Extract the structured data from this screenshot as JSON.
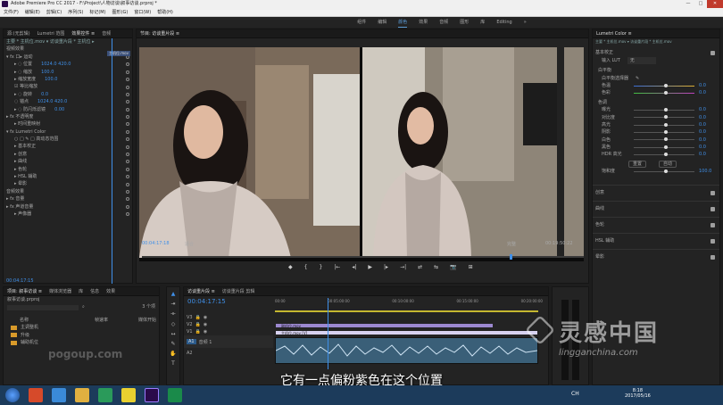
{
  "app": {
    "title": "Adobe Premiere Pro CC 2017 - F:\\Project\\人物访谈\\叙事访谈.prproj *"
  },
  "window_controls": [
    "—",
    "□",
    "✕"
  ],
  "menu": [
    "文件(F)",
    "编辑(E)",
    "剪辑(C)",
    "序列(S)",
    "标记(M)",
    "图形(G)",
    "窗口(W)",
    "帮助(H)"
  ],
  "workspaces": [
    "组件",
    "编辑",
    "颜色",
    "效果",
    "音频",
    "图形",
    "库",
    "Editing",
    "»"
  ],
  "left_panel": {
    "tabs": [
      "源:(无剪辑)",
      "Lumetri 范围",
      "效果控件 ≡",
      "音频"
    ],
    "master_label": "主要 * 主机位.mov ▾ 访谈重片段 * 主机位 ▸",
    "clip_label": "主机位.mov",
    "section": "视频效果",
    "rows": [
      {
        "label": "▾ fx 口▸ 运动",
        "value": ""
      },
      {
        "label": "▸ ◌ 位置",
        "value": "1024.0  420.0"
      },
      {
        "label": "▸ ◌ 缩放",
        "value": "100.0"
      },
      {
        "label": "▸ 缩放宽度",
        "value": "100.0"
      },
      {
        "label": "☑ 等比缩放",
        "value": ""
      },
      {
        "label": "▸ ◌ 旋转",
        "value": "0.0"
      },
      {
        "label": "◌ 锚点",
        "value": "1024.0  420.0"
      },
      {
        "label": "▸ ◌ 防闪烁滤镜",
        "value": "0.00"
      },
      {
        "label": "▸ fx 不透明度",
        "value": ""
      },
      {
        "label": "▸ 时间重映射",
        "value": ""
      },
      {
        "label": "▾ fx Lumetri Color",
        "value": ""
      },
      {
        "label": "○ □ ✎   □ 高动态范围",
        "value": ""
      },
      {
        "label": "▸ 基本校正",
        "value": ""
      },
      {
        "label": "▸ 创意",
        "value": ""
      },
      {
        "label": "▸ 曲线",
        "value": ""
      },
      {
        "label": "▸ 色轮",
        "value": ""
      },
      {
        "label": "▸ HSL 辅助",
        "value": ""
      },
      {
        "label": "▸ 晕影",
        "value": ""
      },
      {
        "label": "音频效果",
        "value": ""
      },
      {
        "label": "▸ fx 音量",
        "value": ""
      },
      {
        "label": "▸ fx 声道音量",
        "value": ""
      },
      {
        "label": "▸ 声像器",
        "value": ""
      }
    ],
    "timecode": "00:04:17:15"
  },
  "program": {
    "tab": "节目: 访谈重片段 ≡",
    "timecode_left": "00:04:17:18",
    "fit": "适合",
    "quality": "完整",
    "timecode_right": "00:19:50:22",
    "controls": [
      "◆",
      "{",
      "}",
      "|←",
      "◂|",
      "▶",
      "|▸",
      "→|",
      "⇄",
      "⇆",
      "📷",
      "⊞"
    ]
  },
  "project": {
    "tabs": [
      "项目: 叙事访谈 ≡",
      "媒体浏览器",
      "库",
      "信息",
      "效果"
    ],
    "file": "叙事访谈.prproj",
    "count": "3 个项",
    "columns": [
      "名称",
      "帧速率",
      "媒体开始"
    ],
    "items": [
      "主调整机",
      "升级",
      "辅助机位"
    ]
  },
  "timeline": {
    "tabs": [
      "访谈重片段 ≡",
      "访谈重片段 剪辑"
    ],
    "timecode": "00:04:17:15",
    "ruler": [
      "00:00",
      "00:05:00:00",
      "00:10:00:00",
      "00:15:00:00",
      "00:20:00:00"
    ],
    "tracks": [
      "V3",
      "V2",
      "V1",
      "A1",
      "A2"
    ],
    "clip_v2": "副机位.mov",
    "clip_v1": "主机位.mov [V]",
    "track_label": "音频 1"
  },
  "lumetri": {
    "tab": "Lumetri Color ≡",
    "target": "主要 * 主机位.mov ▾ 访谈重片段 * 主机位.mov",
    "sections": [
      "基本校正",
      "创意",
      "曲线",
      "色轮",
      "HSL 辅助",
      "晕影"
    ],
    "input_lut": "输入 LUT",
    "input_lut_value": "无",
    "white_balance": "白平衡",
    "wb_selector": "白平衡选择器",
    "temperature": {
      "label": "色温",
      "value": "0.0",
      "level": 0.5
    },
    "tint": {
      "label": "色彩",
      "value": "0.0",
      "level": 0.5
    },
    "tone": "色调",
    "tone_rows": [
      {
        "label": "曝光",
        "value": "0.0",
        "level": 0.5
      },
      {
        "label": "对比度",
        "value": "0.0",
        "level": 0.5
      },
      {
        "label": "高光",
        "value": "0.0",
        "level": 0.5
      },
      {
        "label": "阴影",
        "value": "0.0",
        "level": 0.5
      },
      {
        "label": "白色",
        "value": "0.0",
        "level": 0.5
      },
      {
        "label": "黑色",
        "value": "0.0",
        "level": 0.5
      },
      {
        "label": "HDR 高光",
        "value": "0.0",
        "level": 0.5
      }
    ],
    "buttons": [
      "重置",
      "自动"
    ],
    "saturation": {
      "label": "饱和度",
      "value": "100.0",
      "level": 0.5
    }
  },
  "subtitle": "它有一点偏粉紫色在这个位置",
  "watermarks": {
    "left": "pogoup.com",
    "right_big": "灵感中国",
    "right_small": "lingganchina.com"
  },
  "taskbar": {
    "time": "8:18",
    "date": "2017/05/16",
    "lang": "CH",
    "icons": [
      "start",
      "browser-a",
      "browser-b",
      "explorer",
      "app-green",
      "media",
      "premiere",
      "app-green-2"
    ]
  }
}
